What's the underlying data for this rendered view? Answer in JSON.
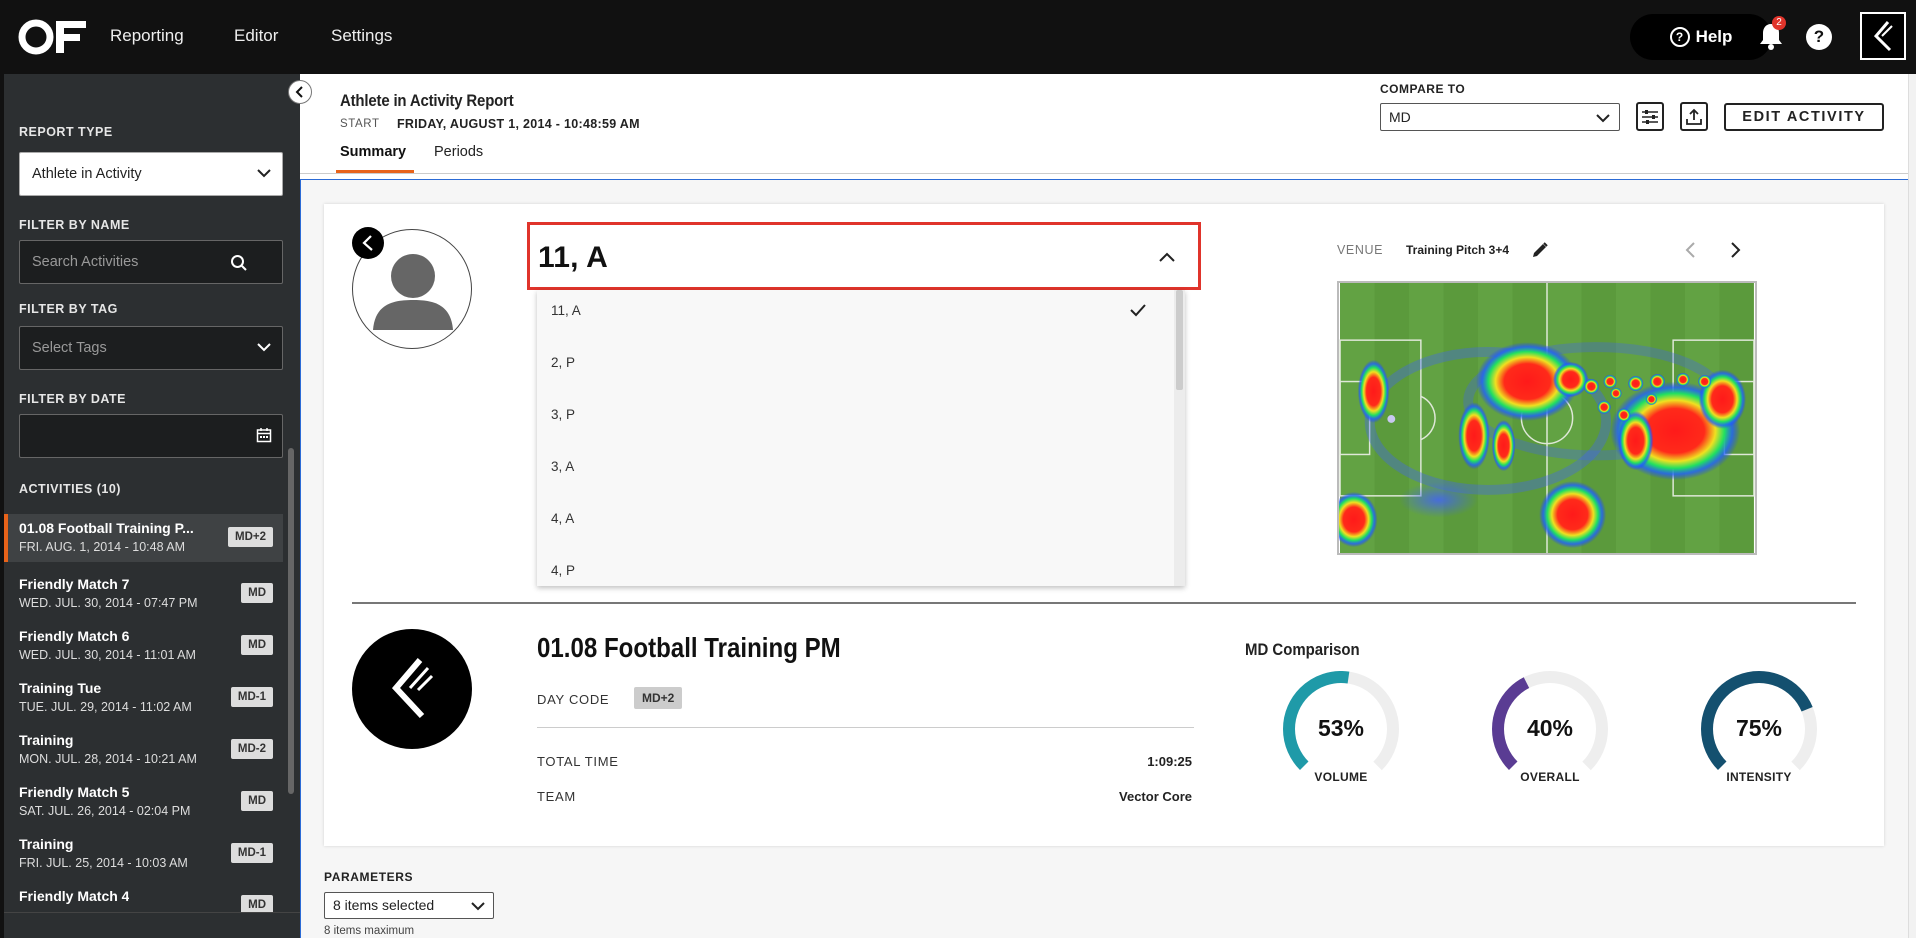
{
  "nav": {
    "items": [
      "Reporting",
      "Editor",
      "Settings"
    ],
    "help_label": "Help",
    "notification_count": "2"
  },
  "sidebar": {
    "report_type_label": "REPORT TYPE",
    "report_type_value": "Athlete in Activity",
    "filter_name_label": "FILTER BY NAME",
    "filter_name_placeholder": "Search Activities",
    "filter_tag_label": "FILTER BY TAG",
    "filter_tag_placeholder": "Select Tags",
    "filter_date_label": "FILTER BY DATE",
    "activities_label": "ACTIVITIES (10)",
    "activities": [
      {
        "title": "01.08 Football Training P...",
        "date": "FRI. AUG. 1, 2014 - 10:48 AM",
        "code": "MD+2"
      },
      {
        "title": "Friendly Match 7",
        "date": "WED. JUL. 30, 2014 - 07:47 PM",
        "code": "MD"
      },
      {
        "title": "Friendly Match 6",
        "date": "WED. JUL. 30, 2014 - 11:01 AM",
        "code": "MD"
      },
      {
        "title": "Training Tue",
        "date": "TUE. JUL. 29, 2014 - 11:02 AM",
        "code": "MD-1"
      },
      {
        "title": "Training",
        "date": "MON. JUL. 28, 2014 - 10:21 AM",
        "code": "MD-2"
      },
      {
        "title": "Friendly Match 5",
        "date": "SAT. JUL. 26, 2014 - 02:04 PM",
        "code": "MD"
      },
      {
        "title": "Training",
        "date": "FRI. JUL. 25, 2014 - 10:03 AM",
        "code": "MD-1"
      },
      {
        "title": "Friendly Match 4",
        "date": "",
        "code": "MD"
      }
    ]
  },
  "header": {
    "title": "Athlete in Activity Report",
    "start_label": "START",
    "start_value": "FRIDAY, AUGUST 1, 2014 - 10:48:59 AM",
    "tabs": [
      "Summary",
      "Periods"
    ],
    "compare_label": "COMPARE TO",
    "compare_value": "MD",
    "edit_label": "EDIT ACTIVITY"
  },
  "athlete": {
    "selected": "11, A",
    "options": [
      "11, A",
      "2, P",
      "3, P",
      "3, A",
      "4, A",
      "4, P"
    ]
  },
  "venue": {
    "label": "VENUE",
    "value": "Training Pitch 3+4"
  },
  "activity": {
    "name": "01.08 Football Training PM",
    "day_code_label": "DAY CODE",
    "day_code": "MD+2",
    "total_time_label": "TOTAL TIME",
    "total_time": "1:09:25",
    "team_label": "TEAM",
    "team": "Vector Core"
  },
  "comparison": {
    "title": "MD Comparison",
    "gauges": [
      {
        "label": "VOLUME",
        "pct": "53%",
        "value": 53,
        "color": "#1f9aa8"
      },
      {
        "label": "OVERALL",
        "pct": "40%",
        "value": 40,
        "color": "#5a3c93"
      },
      {
        "label": "INTENSITY",
        "pct": "75%",
        "value": 75,
        "color": "#14506f"
      }
    ]
  },
  "parameters": {
    "label": "PARAMETERS",
    "value": "8 items selected",
    "note": "8 items maximum"
  },
  "colors": {
    "accent": "#e8631a",
    "highlight": "#e0342b",
    "focus": "#2b6bd6"
  }
}
